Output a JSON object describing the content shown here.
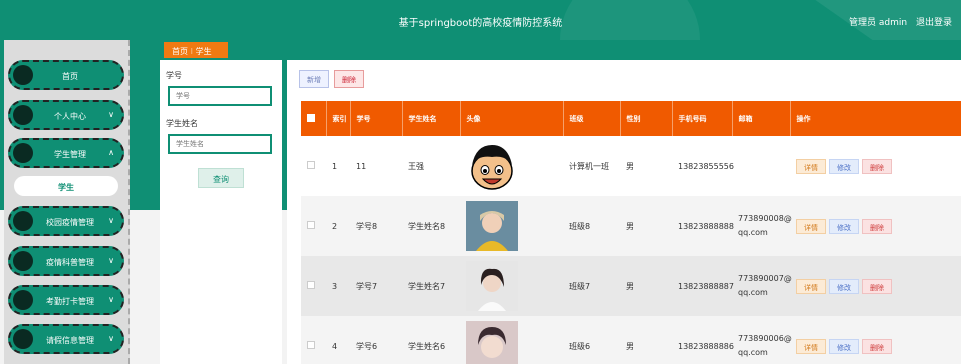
{
  "header": {
    "title": "基于springboot的高校疫情防控系统",
    "user": "管理员 admin",
    "logout": "退出登录"
  },
  "sidebar": {
    "items": [
      {
        "label": "首页",
        "chevron": ""
      },
      {
        "label": "个人中心",
        "chevron": "∨"
      },
      {
        "label": "学生管理",
        "chevron": "∧"
      },
      {
        "label": "校园疫情管理",
        "chevron": "∨"
      },
      {
        "label": "疫情科普管理",
        "chevron": "∨"
      },
      {
        "label": "考勤打卡管理",
        "chevron": "∨"
      },
      {
        "label": "请假信息管理",
        "chevron": "∨"
      }
    ],
    "submenu": "学生"
  },
  "breadcrumb": {
    "home": "首页",
    "sep": "⁝",
    "current": "学生"
  },
  "search": {
    "id_label": "学号",
    "id_placeholder": "学号",
    "name_label": "学生姓名",
    "name_placeholder": "学生姓名",
    "query_button": "查询"
  },
  "toolbar": {
    "add": "新增",
    "delete": "删除"
  },
  "table": {
    "headers": [
      "索引",
      "学号",
      "学生姓名",
      "头像",
      "班级",
      "性别",
      "手机号码",
      "邮箱",
      "操作"
    ],
    "rows": [
      {
        "index": "1",
        "id": "11",
        "name": "王强",
        "class": "计算机一班",
        "gender": "男",
        "phone": "13823855556",
        "email_1": "",
        "email_2": ""
      },
      {
        "index": "2",
        "id": "学号8",
        "name": "学生姓名8",
        "class": "班级8",
        "gender": "男",
        "phone": "13823888888",
        "email_1": "773890008@",
        "email_2": "qq.com"
      },
      {
        "index": "3",
        "id": "学号7",
        "name": "学生姓名7",
        "class": "班级7",
        "gender": "男",
        "phone": "13823888887",
        "email_1": "773890007@",
        "email_2": "qq.com"
      },
      {
        "index": "4",
        "id": "学号6",
        "name": "学生姓名6",
        "class": "班级6",
        "gender": "男",
        "phone": "13823888886",
        "email_1": "773890006@",
        "email_2": "qq.com"
      }
    ],
    "actions": {
      "detail": "详情",
      "edit": "修改",
      "remove": "删除"
    }
  },
  "colors": {
    "primary": "#0f8f74",
    "accent": "#f05a00",
    "breadcrumb": "#f07a12"
  }
}
